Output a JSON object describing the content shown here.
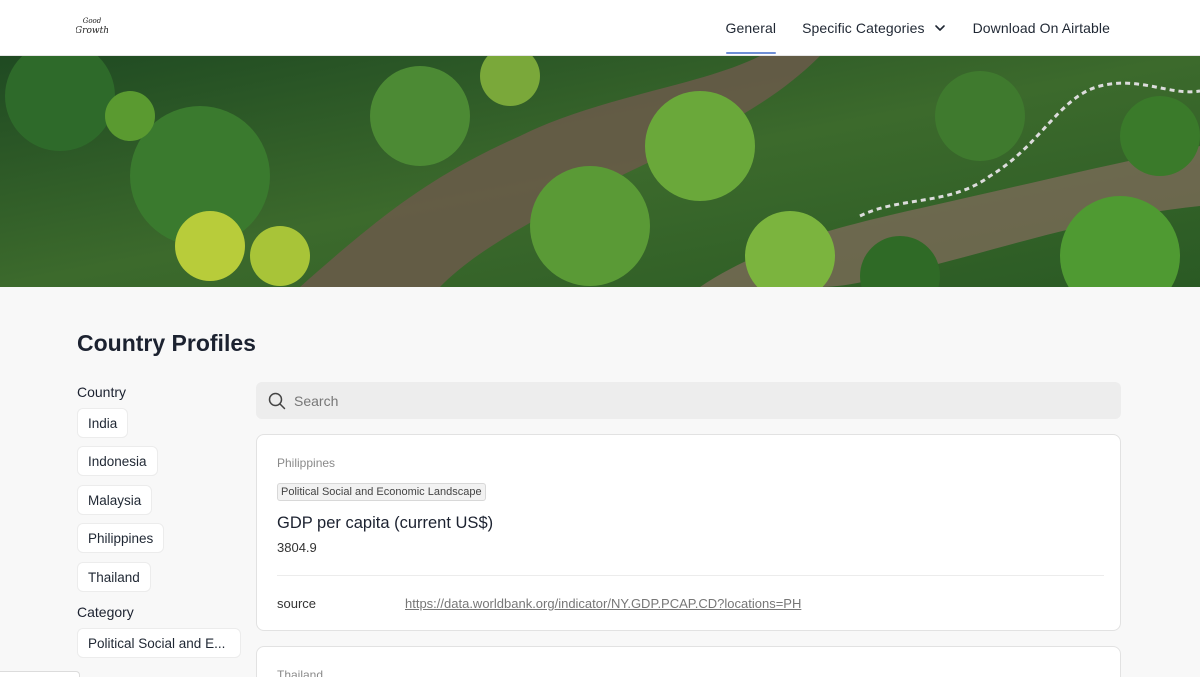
{
  "header": {
    "logo_text": "Good Growth",
    "nav": [
      {
        "label": "General",
        "active": true
      },
      {
        "label": "Specific Categories",
        "has_dropdown": true
      },
      {
        "label": "Download On Airtable"
      }
    ]
  },
  "page": {
    "title": "Country Profiles"
  },
  "filters": {
    "country_heading": "Country",
    "countries": [
      "India",
      "Indonesia",
      "Malaysia",
      "Philippines",
      "Thailand"
    ],
    "category_heading": "Category",
    "categories": [
      "Political Social and E..."
    ]
  },
  "search": {
    "placeholder": "Search"
  },
  "cards": [
    {
      "country": "Philippines",
      "tag": "Political Social and Economic Landscape",
      "title": "GDP per capita (current US$)",
      "value": "3804.9",
      "source_label": "source",
      "source_url": "https://data.worldbank.org/indicator/NY.GDP.PCAP.CD?locations=PH"
    },
    {
      "country": "Thailand"
    }
  ],
  "colors": {
    "accent_underline": "#6f8fd6",
    "page_background": "#f8f8f8"
  }
}
